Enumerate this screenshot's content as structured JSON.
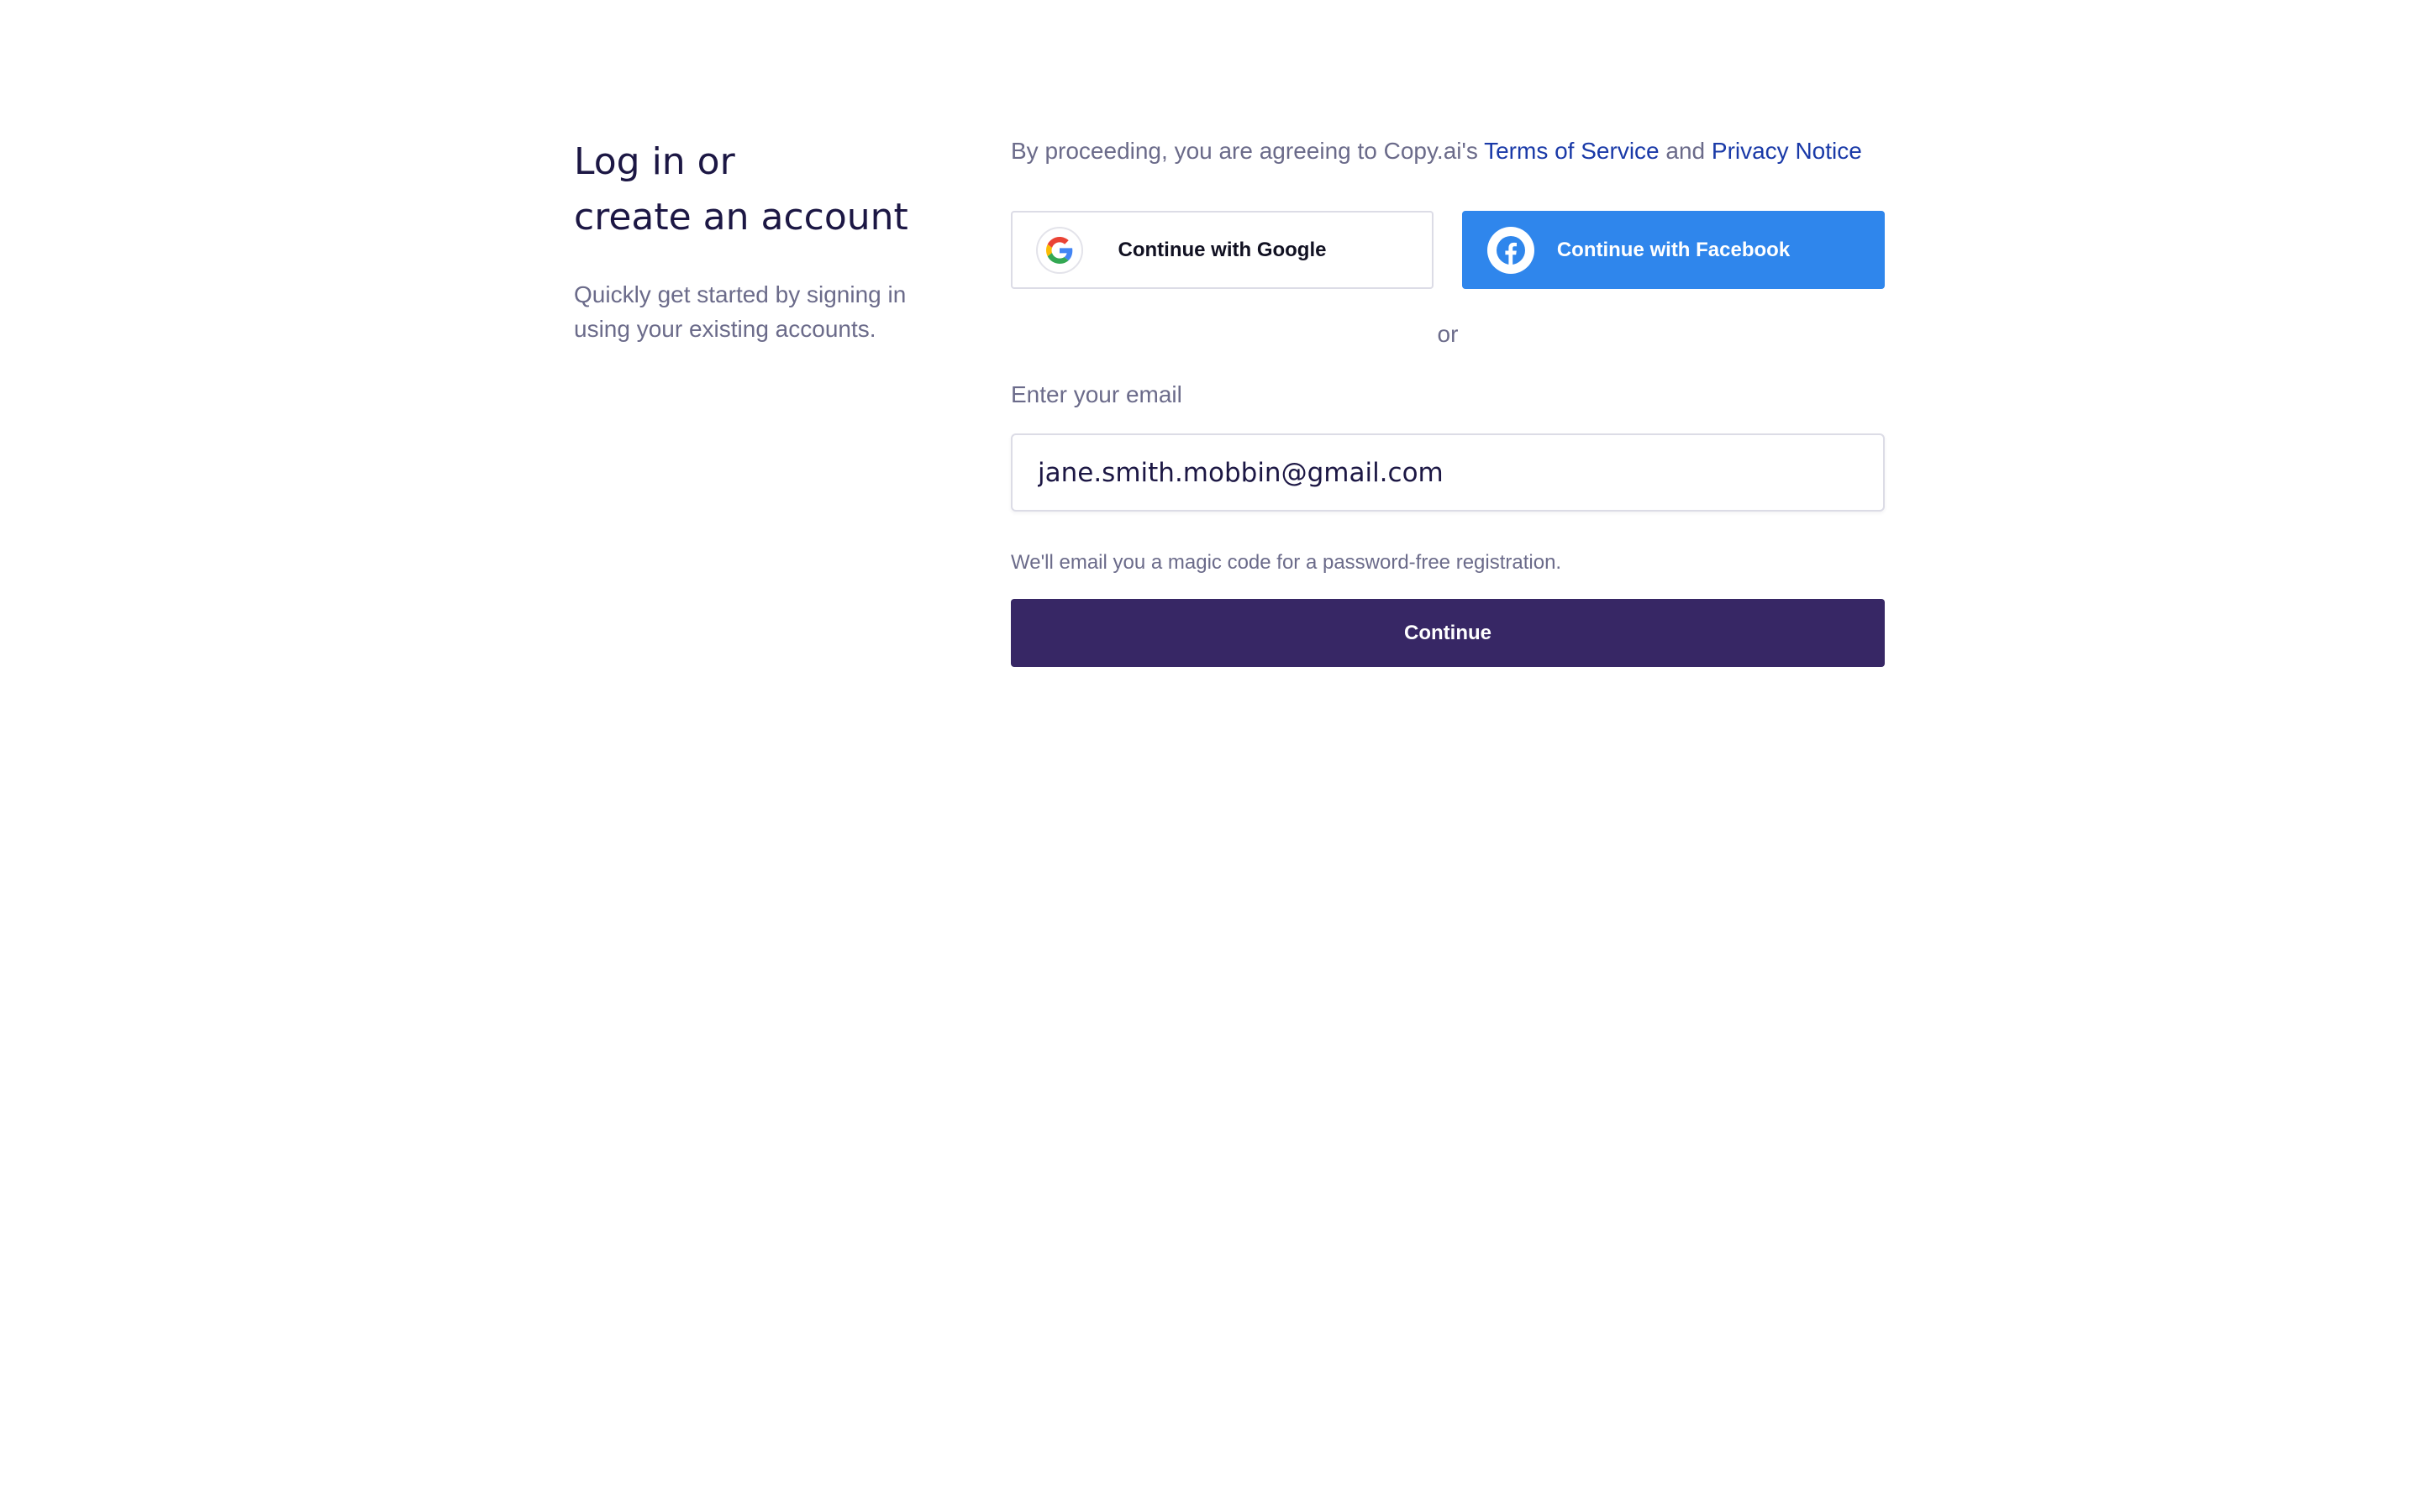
{
  "intro": {
    "title_line1": "Log in or",
    "title_line2": "create an account",
    "subtitle": "Quickly get started by signing in using your existing accounts."
  },
  "legal": {
    "prefix": "By proceeding, you are agreeing to Copy.ai's ",
    "terms_link": "Terms of Service",
    "conjunction": " and ",
    "privacy_link": "Privacy Notice",
    "link_color": "#1a3aa8"
  },
  "social": {
    "google_label": "Continue with Google",
    "google_icon": "google-g-icon",
    "facebook_label": "Continue with Facebook",
    "facebook_icon": "facebook-f-icon",
    "facebook_color": "#2f86ec"
  },
  "divider": {
    "label": "or"
  },
  "email": {
    "label": "Enter your email",
    "value": "jane.smith.mobbin@gmail.com"
  },
  "hint": "We'll email you a magic code for a password-free registration.",
  "continue_label": "Continue",
  "colors": {
    "heading": "#1c1744",
    "muted_text": "#6b6b8a",
    "continue_button": "#372765"
  }
}
